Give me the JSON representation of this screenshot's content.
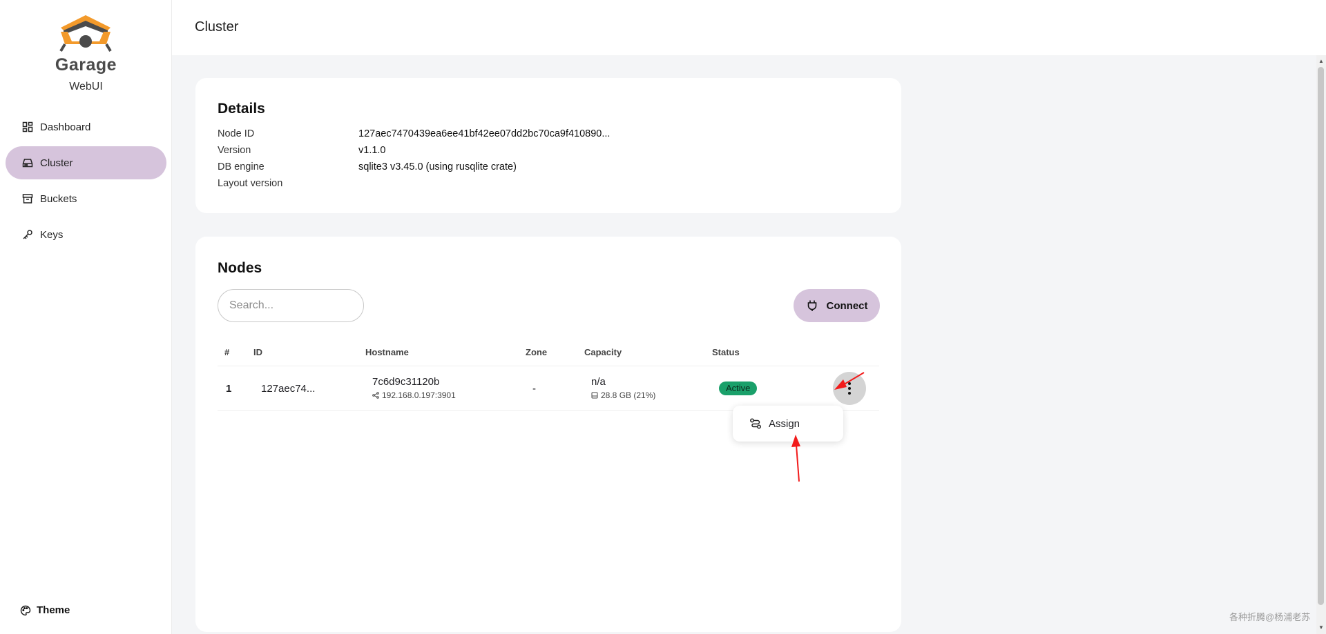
{
  "sidebar": {
    "brand": "Garage",
    "subtitle": "WebUI",
    "items": [
      {
        "label": "Dashboard",
        "icon": "dashboard-icon"
      },
      {
        "label": "Cluster",
        "icon": "hard-drive-icon",
        "active": true
      },
      {
        "label": "Buckets",
        "icon": "archive-icon"
      },
      {
        "label": "Keys",
        "icon": "key-icon"
      }
    ],
    "theme_label": "Theme"
  },
  "header": {
    "title": "Cluster"
  },
  "details": {
    "title": "Details",
    "rows": [
      {
        "label": "Node ID",
        "value": "127aec7470439ea6ee41bf42ee07dd2bc70ca9f410890..."
      },
      {
        "label": "Version",
        "value": "v1.1.0"
      },
      {
        "label": "DB engine",
        "value": "sqlite3 v3.45.0 (using rusqlite crate)"
      },
      {
        "label": "Layout version",
        "value": ""
      }
    ]
  },
  "nodes": {
    "title": "Nodes",
    "search_placeholder": "Search...",
    "connect_label": "Connect",
    "columns": [
      "#",
      "ID",
      "Hostname",
      "Zone",
      "Capacity",
      "Status"
    ],
    "rows": [
      {
        "num": "1",
        "id": "127aec74...",
        "hostname": "7c6d9c31120b",
        "address": "192.168.0.197:3901",
        "zone": "-",
        "capacity": "n/a",
        "disk": "28.8 GB (21%)",
        "status": "Active"
      }
    ],
    "menu": {
      "assign_label": "Assign"
    }
  },
  "colors": {
    "accent": "#d6c4dc",
    "status_active": "#1aa06a",
    "annotation_arrow": "#f21b1b"
  },
  "watermark": "各种折腾@杨浦老苏"
}
